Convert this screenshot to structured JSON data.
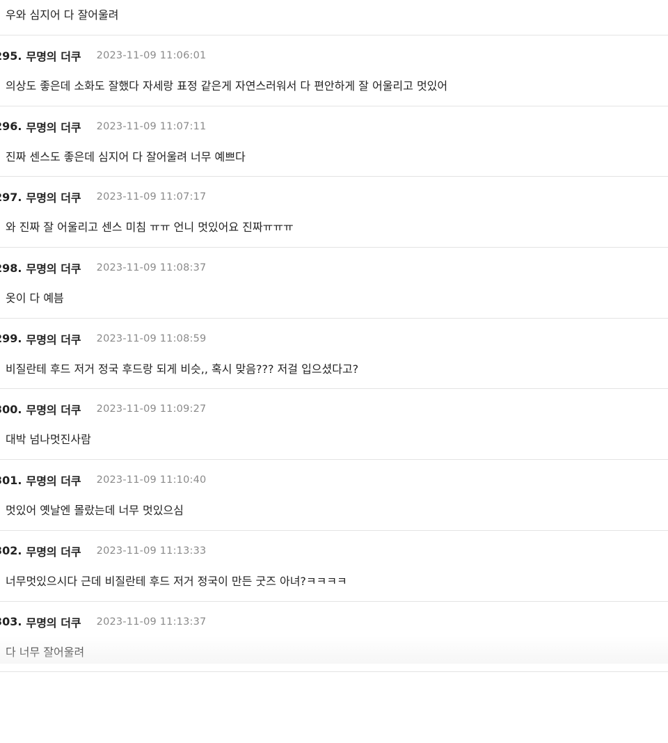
{
  "comments": [
    {
      "number": "",
      "author": "",
      "time": "",
      "text": "우와 심지어 다 잘어울려"
    },
    {
      "number": "295.",
      "author": "무명의 더쿠",
      "time": "2023-11-09 11:06:01",
      "text": "의상도 좋은데 소화도 잘했다 자세랑 표정 같은게 자연스러워서 다 편안하게 잘 어울리고 멋있어"
    },
    {
      "number": "296.",
      "author": "무명의 더쿠",
      "time": "2023-11-09 11:07:11",
      "text": "진짜 센스도 좋은데 심지어 다 잘어울려 너무 예쁘다"
    },
    {
      "number": "297.",
      "author": "무명의 더쿠",
      "time": "2023-11-09 11:07:17",
      "text": "와 진짜 잘 어울리고 센스 미침 ㅠㅠ 언니 멋있어요 진짜ㅠㅠㅠ"
    },
    {
      "number": "298.",
      "author": "무명의 더쿠",
      "time": "2023-11-09 11:08:37",
      "text": "옷이 다 예븜"
    },
    {
      "number": "299.",
      "author": "무명의 더쿠",
      "time": "2023-11-09 11:08:59",
      "text": "비질란테 후드 저거 정국 후드랑 되게 비슷,, 혹시 맞음??? 저걸 입으셨다고?"
    },
    {
      "number": "300.",
      "author": "무명의 더쿠",
      "time": "2023-11-09 11:09:27",
      "text": "대박 넘나멋진사람"
    },
    {
      "number": "301.",
      "author": "무명의 더쿠",
      "time": "2023-11-09 11:10:40",
      "text": "멋있어 옛날엔 몰랐는데 너무 멋있으심"
    },
    {
      "number": "302.",
      "author": "무명의 더쿠",
      "time": "2023-11-09 11:13:33",
      "text": "너무멋있으시다 근데 비질란테 후드 저거 정국이 만든 굿즈 아녀?ㅋㅋㅋㅋ"
    },
    {
      "number": "303.",
      "author": "무명의 더쿠",
      "time": "2023-11-09 11:13:37",
      "text": "다 너무 잘어울려",
      "emoji": "👍👍"
    }
  ],
  "icons": {
    "thumbs_up": "thumbs-up-icon"
  }
}
